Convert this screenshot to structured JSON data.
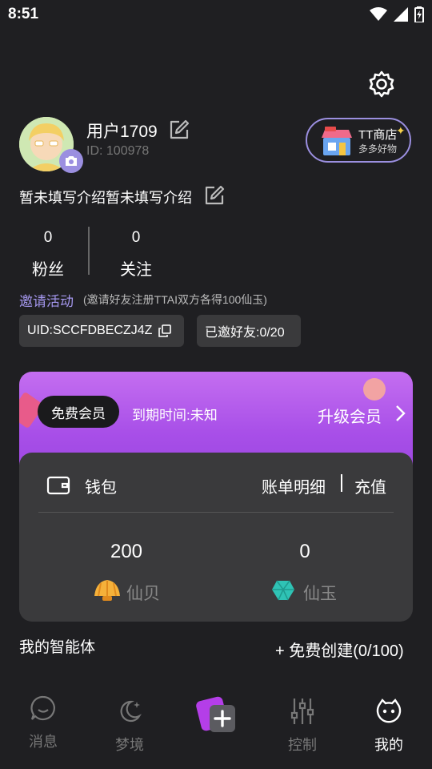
{
  "status_bar": {
    "time": "8:51"
  },
  "profile": {
    "username": "用户1709",
    "user_id": "ID: 100978",
    "bio": "暂未填写介绍暂未填写介绍"
  },
  "shop": {
    "title": "TT商店",
    "subtitle": "多多好物"
  },
  "stats": {
    "fans": {
      "count": "0",
      "label": "粉丝"
    },
    "follow": {
      "count": "0",
      "label": "关注"
    }
  },
  "invite": {
    "title": "邀请活动",
    "description": "(邀请好友注册TTAI双方各得100仙玉)",
    "uid_text": "UID:SCCFDBECZJ4Z",
    "invited_text": "已邀好友:0/20"
  },
  "vip": {
    "badge": "免费会员",
    "expire": "到期时间:未知",
    "upgrade": "升级会员"
  },
  "wallet": {
    "title": "钱包",
    "bill_link": "账单明细",
    "recharge": "充值",
    "shell": {
      "value": "200",
      "label": "仙贝"
    },
    "jade": {
      "value": "0",
      "label": "仙玉"
    }
  },
  "agents": {
    "title": "我的智能体",
    "create": "+ 免费创建(0/100)"
  },
  "tabs": [
    {
      "label": "消息",
      "icon": "chat-smile-icon"
    },
    {
      "label": "梦境",
      "icon": "moon-star-icon"
    },
    {
      "label": "",
      "icon": "create-plus-icon"
    },
    {
      "label": "控制",
      "icon": "sliders-icon"
    },
    {
      "label": "我的",
      "icon": "face-icon"
    }
  ],
  "colors": {
    "accent": "#a497ee",
    "vip_gradient_top": "#c46ef0",
    "vip_gradient_bottom": "#9a45e0",
    "background": "#1f1f22",
    "card": "#3a3a3c"
  }
}
